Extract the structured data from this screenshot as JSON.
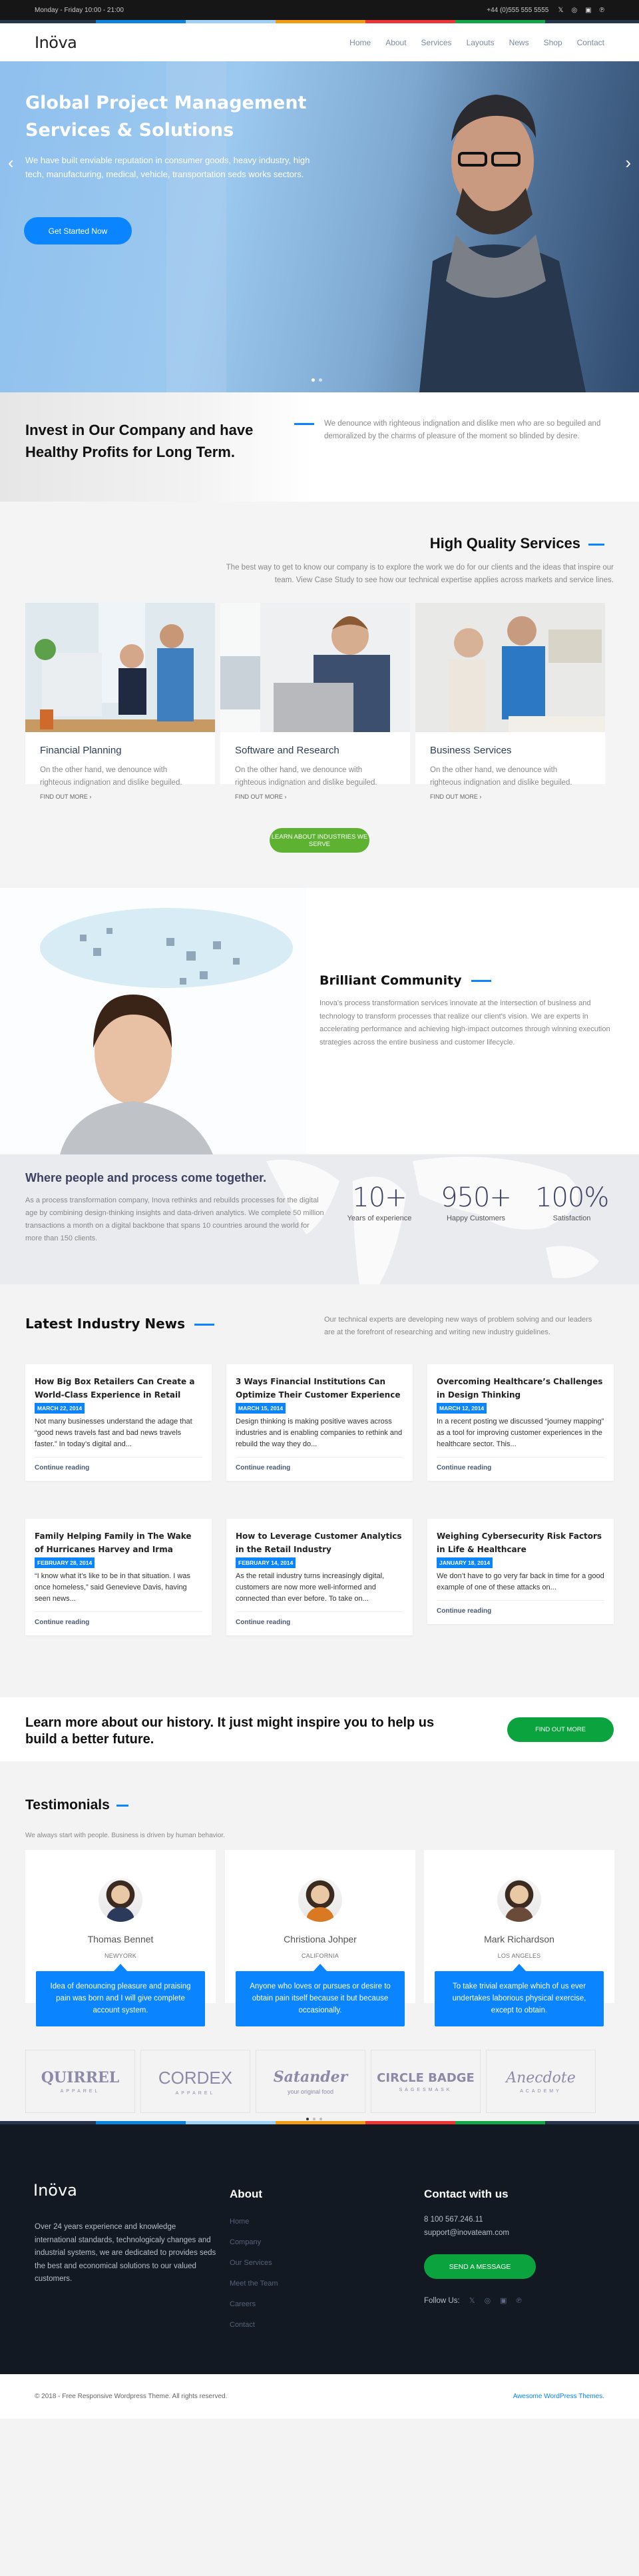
{
  "topbar": {
    "hours": "Monday - Friday 10:00 - 21:00",
    "phone": "+44 (0)555 555 5555",
    "social_icons": [
      "twitter-icon",
      "instagram-icon",
      "youtube-icon",
      "pinterest-icon"
    ]
  },
  "brand": {
    "logo": "Inöva",
    "accent": "#0a84ff",
    "stripe_colors": [
      "#0a84e0",
      "#9fd0f7",
      "#f39c12",
      "#ee3434",
      "#12a849"
    ]
  },
  "nav": {
    "items": [
      "Home",
      "About",
      "Services",
      "Layouts",
      "News",
      "Shop",
      "Contact"
    ]
  },
  "hero": {
    "title": "Global Project Management Services & Solutions",
    "text": "We have built enviable reputation in consumer goods, heavy industry, high tech, manufacturing, medical, vehicle, transportation seds works sectors.",
    "button": "Get Started Now",
    "prev_icon": "‹",
    "next_icon": "›",
    "slides": 2,
    "active_slide": 1
  },
  "invest": {
    "title": "Invest in Our Company and have Healthy Profits for Long Term.",
    "text": "We denounce with righteous indignation and dislike men who are so beguiled and demoralized by the charms of pleasure of the moment so blinded by desire."
  },
  "services": {
    "title": "High Quality Services",
    "intro": "The best way to get to know our company is to explore the work we do for our clients and the ideas that inspire our team. View Case Study to see how our technical expertise applies across markets and service lines.",
    "cards": [
      {
        "title": "Financial Planning",
        "text": "On the other hand, we denounce with righteous indignation and dislike beguiled.",
        "link": "FIND OUT MORE"
      },
      {
        "title": "Software and Research",
        "text": "On the other hand, we denounce with righteous indignation and dislike beguiled.",
        "link": "FIND OUT MORE"
      },
      {
        "title": "Business Services",
        "text": "On the other hand, we denounce with righteous indignation and dislike beguiled.",
        "link": "FIND OUT MORE"
      }
    ],
    "button": "LEARN ABOUT INDUSTRIES WE SERVE"
  },
  "community": {
    "title": "Brilliant Community",
    "text": "Inova's process transformation services innovate at the intersection of business and technology to transform processes that realize our client's vision. We are experts in accelerating performance and achieving high-impact outcomes through winning execution strategies across the entire business and customer lifecycle."
  },
  "stats": {
    "title": "Where people and process come together.",
    "text": "As a process transformation company, Inova rethinks and rebuilds processes for the digital age by combining design-thinking insights and data-driven analytics. We complete 50 million transactions a month on a digital backbone that spans 10 countries around the world for more than 150 clients.",
    "items": [
      {
        "value": "10+",
        "label": "Years of experience"
      },
      {
        "value": "950+",
        "label": "Happy Customers"
      },
      {
        "value": "100%",
        "label": "Satisfaction"
      }
    ]
  },
  "news": {
    "title": "Latest Industry News",
    "intro": "Our technical experts are developing new ways of problem solving and our leaders are at the forefront of researching and writing new industry guidelines.",
    "continue_label": "Continue reading",
    "posts": [
      {
        "title": "How Big Box Retailers Can Create a World-Class Experience in Retail",
        "date": "MARCH 22, 2014",
        "excerpt": "Not many businesses understand the adage that “good news travels fast and bad news travels faster.” In today’s digital and..."
      },
      {
        "title": "3 Ways Financial Institutions Can Optimize Their Customer Experience",
        "date": "MARCH 15, 2014",
        "excerpt": "Design thinking is making positive waves across industries and is enabling companies to rethink and rebuild the way they do..."
      },
      {
        "title": "Overcoming Healthcare’s Challenges in Design Thinking",
        "date": "MARCH 12, 2014",
        "excerpt": "In a recent posting we discussed “journey mapping” as a tool for improving customer experiences in the healthcare sector. This..."
      },
      {
        "title": "Family Helping Family in The Wake of Hurricanes Harvey and Irma",
        "date": "FEBRUARY 28, 2014",
        "excerpt": "“I know what it’s like to be in that situation. I was once homeless,” said Genevieve Davis, having seen news..."
      },
      {
        "title": "How to Leverage Customer Analytics in the Retail Industry",
        "date": "FEBRUARY 14, 2014",
        "excerpt": "As the retail industry turns increasingly digital, customers are now more well-informed and connected than ever before. To take on..."
      },
      {
        "title": "Weighing Cybersecurity Risk Factors in Life & Healthcare",
        "date": "JANUARY 18, 2014",
        "excerpt": "We don’t have to go very far back in time for a good example of one of these attacks on..."
      }
    ]
  },
  "cta": {
    "text": "Learn more about our history. It just might inspire you to help us build a better future.",
    "button": "FIND OUT MORE"
  },
  "testimonials": {
    "title": "Testimonials",
    "intro": "We always start with people. Business is driven by human behavior.",
    "items": [
      {
        "name": "Thomas Bennet",
        "location": "NEWYORK",
        "quote": "Idea of denouncing pleasure and praising pain was born and I will give complete account system.",
        "shirt": "#2b3a5a"
      },
      {
        "name": "Christiona Johper",
        "location": "CALIFORNIA",
        "quote": "Anyone who loves or pursues or desire to obtain pain itself because it but because occasionally.",
        "shirt": "#d97a22"
      },
      {
        "name": "Mark Richardson",
        "location": "LOS ANGELES",
        "quote": "To take trivial example which of us ever undertakes laborious physical exercise, except to obtain.",
        "shirt": "#6a4b3a"
      }
    ],
    "partners": [
      {
        "name": "QUIRREL",
        "sub": "APPAREL"
      },
      {
        "name": "CORDEX",
        "sub": "APPAREL"
      },
      {
        "name": "Satander",
        "sub": "your original food"
      },
      {
        "name": "CIRCLE BADGE",
        "sub": "SAGESMASK"
      },
      {
        "name": "Anecdote",
        "sub": "ACADEMY"
      }
    ],
    "partner_pages": 3,
    "active_partner_page": 1
  },
  "footer": {
    "logo": "Inöva",
    "description": "Over 24 years experience and knowledge international standards, technologicaly changes and industrial systems, we are dedicated to provides seds the best and economical solutions to our valued customers.",
    "about_title": "About",
    "about_links": [
      "Home",
      "Company",
      "Our Services",
      "Meet the Team",
      "Careers",
      "Contact"
    ],
    "contact_title": "Contact with us",
    "phone": "8 100 567.246.11",
    "email": "support@inovateam.com",
    "button": "SEND A MESSAGE",
    "follow_label": "Follow Us:"
  },
  "bottom": {
    "copyright": "© 2018 - Free Responsive Wordpress Theme. All rights reserved.",
    "link": "Awesome WordPress Themes."
  }
}
